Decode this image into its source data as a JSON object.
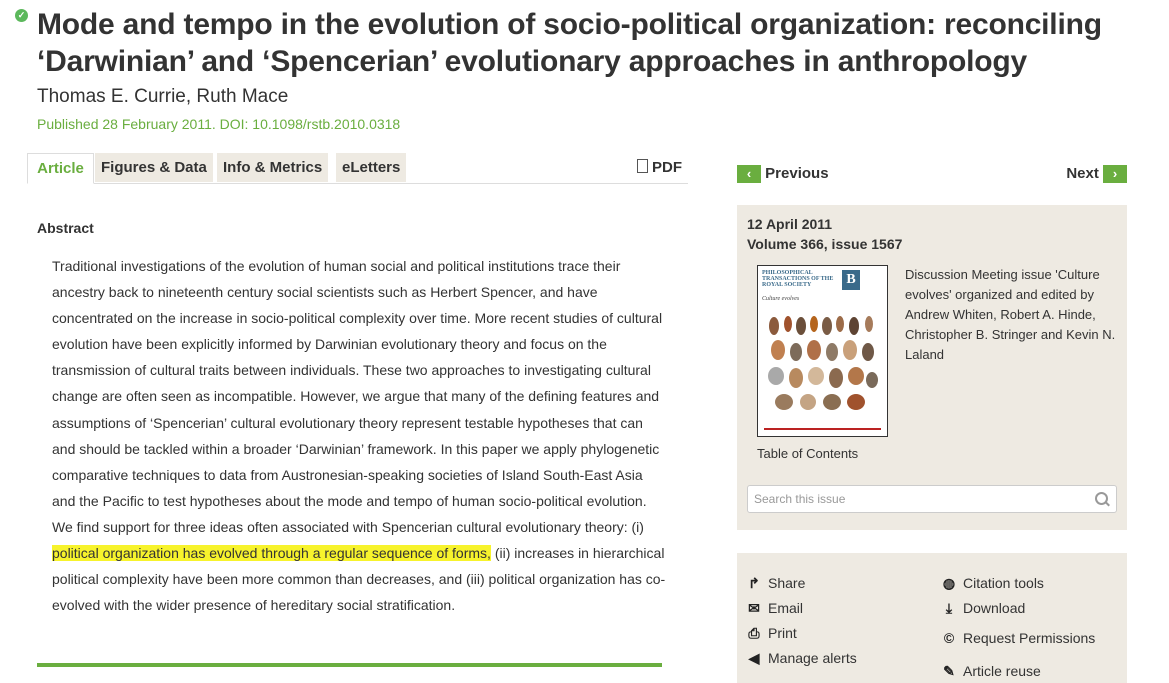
{
  "article": {
    "title": "Mode and tempo in the evolution of socio-political organization: reconciling ‘Darwinian’ and ‘Spencerian’ evolutionary approaches in anthropology",
    "authors": "Thomas E. Currie, Ruth Mace",
    "published": "Published 28 February 2011. DOI: 10.1098/rstb.2010.0318"
  },
  "tabs": [
    "Article",
    "Figures & Data",
    "Info & Metrics",
    "eLetters"
  ],
  "pdf_label": "PDF",
  "abstract": {
    "heading": "Abstract",
    "text_before": "Traditional investigations of the evolution of human social and political institutions trace their ancestry back to nineteenth century social scientists such as Herbert Spencer, and have concentrated on the increase in socio-political complexity over time. More recent studies of cultural evolution have been explicitly informed by Darwinian evolutionary theory and focus on the transmission of cultural traits between individuals. These two approaches to investigating cultural change are often seen as incompatible. However, we argue that many of the defining features and assumptions of ‘Spencerian’ cultural evolutionary theory represent testable hypotheses that can and should be tackled within a broader ‘Darwinian’ framework. In this paper we apply phylogenetic comparative techniques to data from Austronesian-speaking societies of Island South-East Asia and the Pacific to test hypotheses about the mode and tempo of human socio-political evolution. We find support for three ideas often associated with Spencerian cultural evolutionary theory: (i) ",
    "text_highlighted": "political organization has evolved through a regular sequence of forms,",
    "text_after": " (ii) increases in hierarchical political complexity have been more common than decreases, and (iii) political organization has co-evolved with the wider presence of hereditary social stratification."
  },
  "nav": {
    "previous": "Previous",
    "next": "Next"
  },
  "issue": {
    "date": "12 April 2011",
    "volume": "Volume 366, issue 1567",
    "cover_journal": "PHILOSOPHICAL TRANSACTIONS OF THE ROYAL SOCIETY",
    "cover_letter": "B",
    "cover_subtitle": "Culture evolves",
    "toc_label": "Table of Contents",
    "description": "Discussion Meeting issue 'Culture evolves' organized and edited by Andrew Whiten, Robert A. Hinde, Christopher B. Stringer and Kevin N. Laland",
    "search_placeholder": "Search this issue"
  },
  "tools": {
    "share": "Share",
    "email": "Email",
    "print": "Print",
    "manage_alerts": "Manage alerts",
    "citation_tools": "Citation tools",
    "download": "Download",
    "request_permissions": "Request Permissions",
    "article_reuse": "Article reuse"
  },
  "colors": {
    "accent": "#6aae3f",
    "panel": "#eeeae2",
    "highlight": "#f7f32c"
  }
}
